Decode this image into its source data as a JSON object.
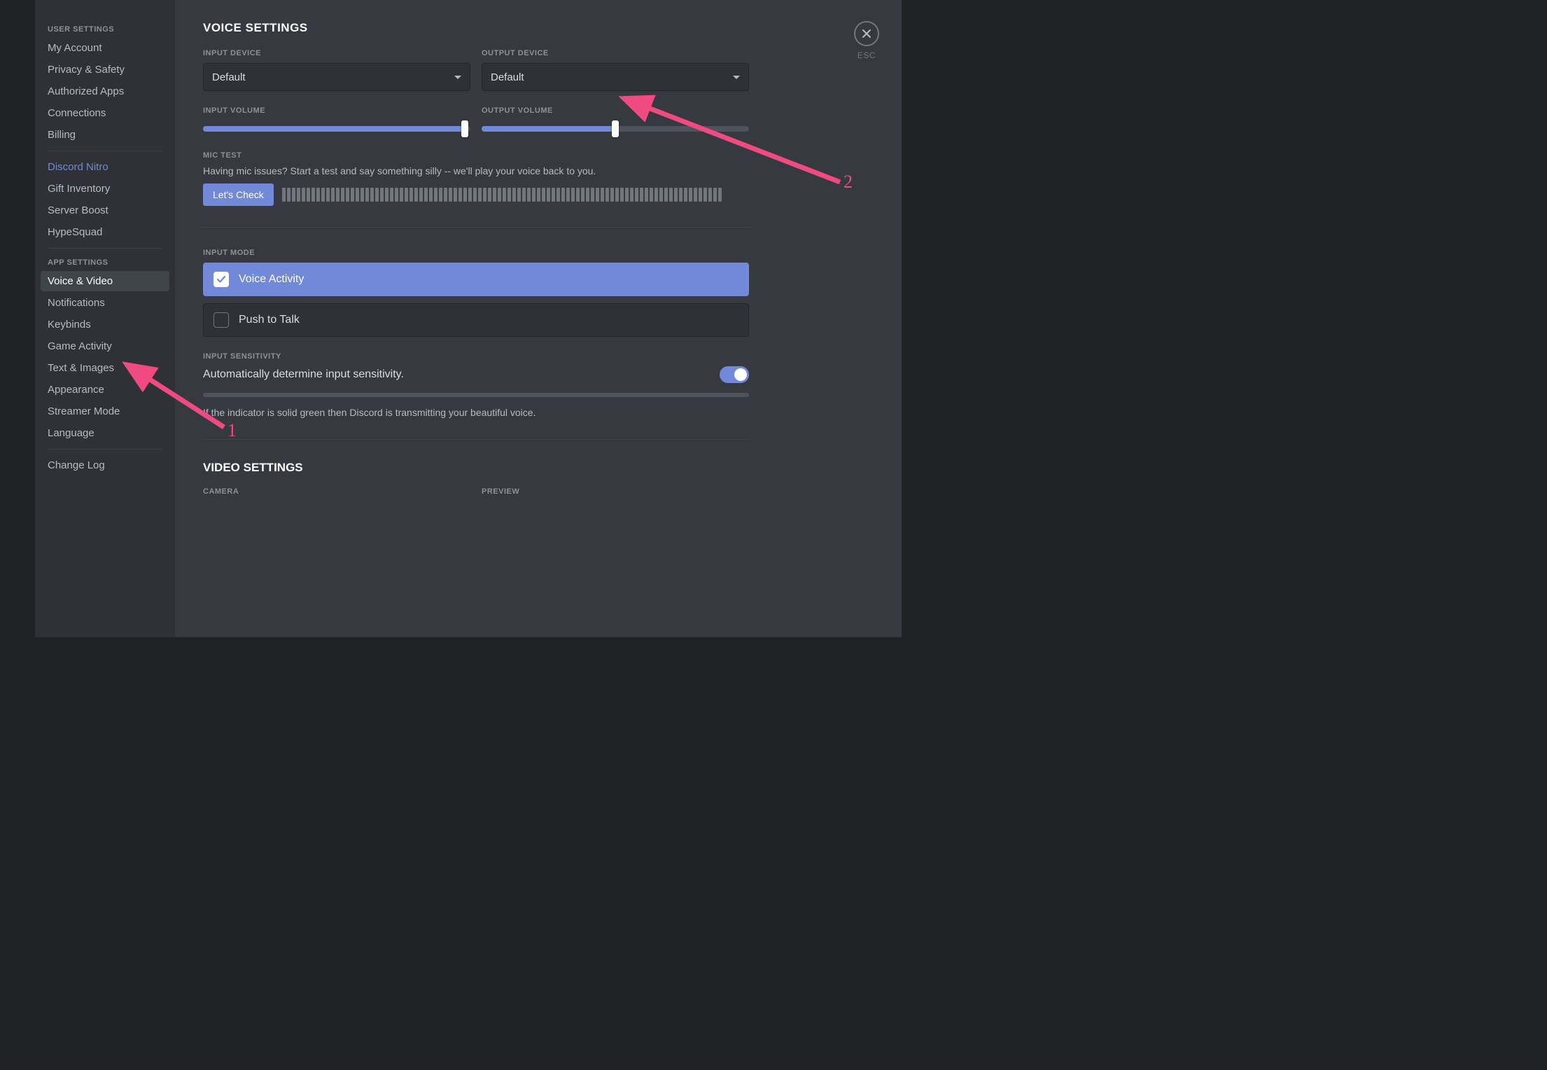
{
  "sidebar": {
    "heading1": "USER SETTINGS",
    "items1": [
      "My Account",
      "Privacy & Safety",
      "Authorized Apps",
      "Connections",
      "Billing"
    ],
    "nitro": "Discord Nitro",
    "items2": [
      "Gift Inventory",
      "Server Boost",
      "HypeSquad"
    ],
    "heading2": "APP SETTINGS",
    "items3": [
      "Voice & Video",
      "Notifications",
      "Keybinds",
      "Game Activity",
      "Text & Images",
      "Appearance",
      "Streamer Mode",
      "Language"
    ],
    "changelog": "Change Log"
  },
  "close": {
    "esc": "ESC"
  },
  "voice": {
    "title": "VOICE SETTINGS",
    "input_device_label": "INPUT DEVICE",
    "input_device_value": "Default",
    "output_device_label": "OUTPUT DEVICE",
    "output_device_value": "Default",
    "input_volume_label": "INPUT VOLUME",
    "output_volume_label": "OUTPUT VOLUME",
    "input_volume_percent": 98,
    "output_volume_percent": 50,
    "mic_test_label": "MIC TEST",
    "mic_test_help": "Having mic issues? Start a test and say something silly -- we'll play your voice back to you.",
    "lets_check": "Let's Check",
    "input_mode_label": "INPUT MODE",
    "mode_va": "Voice Activity",
    "mode_ptt": "Push to Talk",
    "sens_label": "INPUT SENSITIVITY",
    "sens_auto": "Automatically determine input sensitivity.",
    "sens_help": "If the indicator is solid green then Discord is transmitting your beautiful voice."
  },
  "video": {
    "title": "VIDEO SETTINGS",
    "camera_label": "CAMERA",
    "preview_label": "PREVIEW"
  },
  "annotations": {
    "a1": "1",
    "a2": "2"
  }
}
